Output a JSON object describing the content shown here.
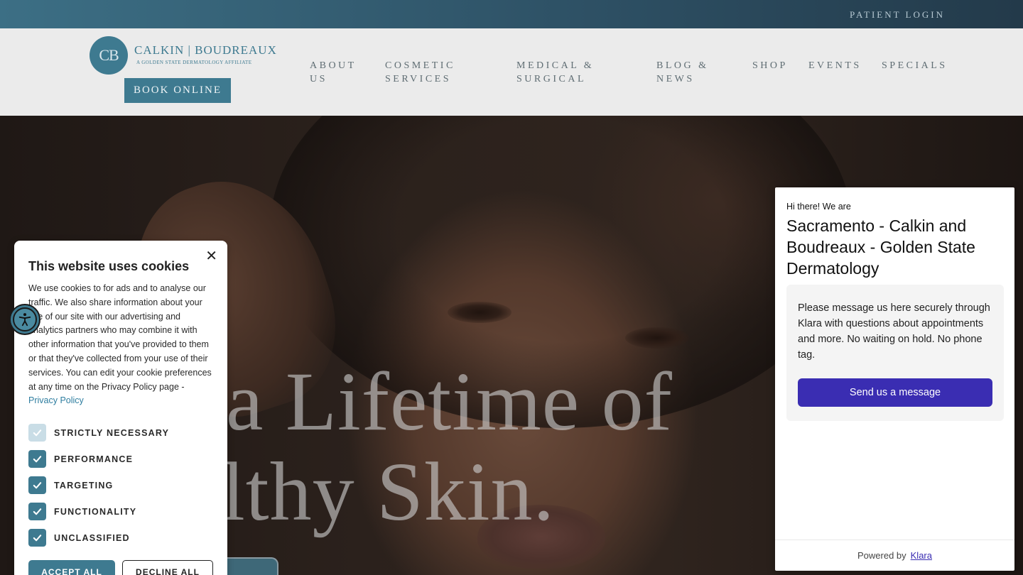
{
  "topbar": {
    "patient_login": "PATIENT LOGIN"
  },
  "header": {
    "logo": {
      "monogram": "CB",
      "name": "CALKIN | BOUDREAUX",
      "tagline": "A GOLDEN STATE DERMATOLOGY AFFILIATE"
    },
    "book_online": "BOOK ONLINE",
    "nav": [
      {
        "line1": "ABOUT",
        "line2": "US"
      },
      {
        "line1": "COSMETIC",
        "line2": "SERVICES"
      },
      {
        "line1": "MEDICAL &",
        "line2": "SURGICAL"
      },
      {
        "line1": "BLOG &",
        "line2": "NEWS"
      },
      {
        "line1": "SHOP",
        "line2": ""
      },
      {
        "line1": "EVENTS",
        "line2": ""
      },
      {
        "line1": "SPECIALS",
        "line2": ""
      }
    ]
  },
  "hero": {
    "line1": "a Lifetime of",
    "line2": "lthy Skin."
  },
  "cookie": {
    "title": "This website uses cookies",
    "body": "We use cookies to for ads and to analyse our traffic. We also share information about your use of our site with our advertising and analytics partners who may combine it with other information that you've provided to them or that they've collected from your use of their services. You can edit your cookie preferences at any time on the Privacy Policy page - ",
    "privacy_link": "Privacy Policy",
    "close_icon": "close-icon",
    "options": [
      {
        "label": "STRICTLY NECESSARY",
        "checked": true,
        "disabled": true
      },
      {
        "label": "PERFORMANCE",
        "checked": true,
        "disabled": false
      },
      {
        "label": "TARGETING",
        "checked": true,
        "disabled": false
      },
      {
        "label": "FUNCTIONALITY",
        "checked": true,
        "disabled": false
      },
      {
        "label": "UNCLASSIFIED",
        "checked": true,
        "disabled": false
      }
    ],
    "accept": "ACCEPT ALL",
    "decline": "DECLINE ALL"
  },
  "accessibility": {
    "icon": "accessibility-icon"
  },
  "chat": {
    "greeting": "Hi there! We are",
    "name": "Sacramento - Calkin and Boudreaux - Golden State Dermatology",
    "message": "Please message us here securely through Klara with questions about appointments and more. No waiting on hold. No phone tag.",
    "button": "Send us a message",
    "powered_by": "Powered by",
    "provider": "Klara"
  },
  "colors": {
    "brand": "#3e7a90",
    "chat_button": "#3a2db2",
    "header_bg": "#ebebeb"
  }
}
